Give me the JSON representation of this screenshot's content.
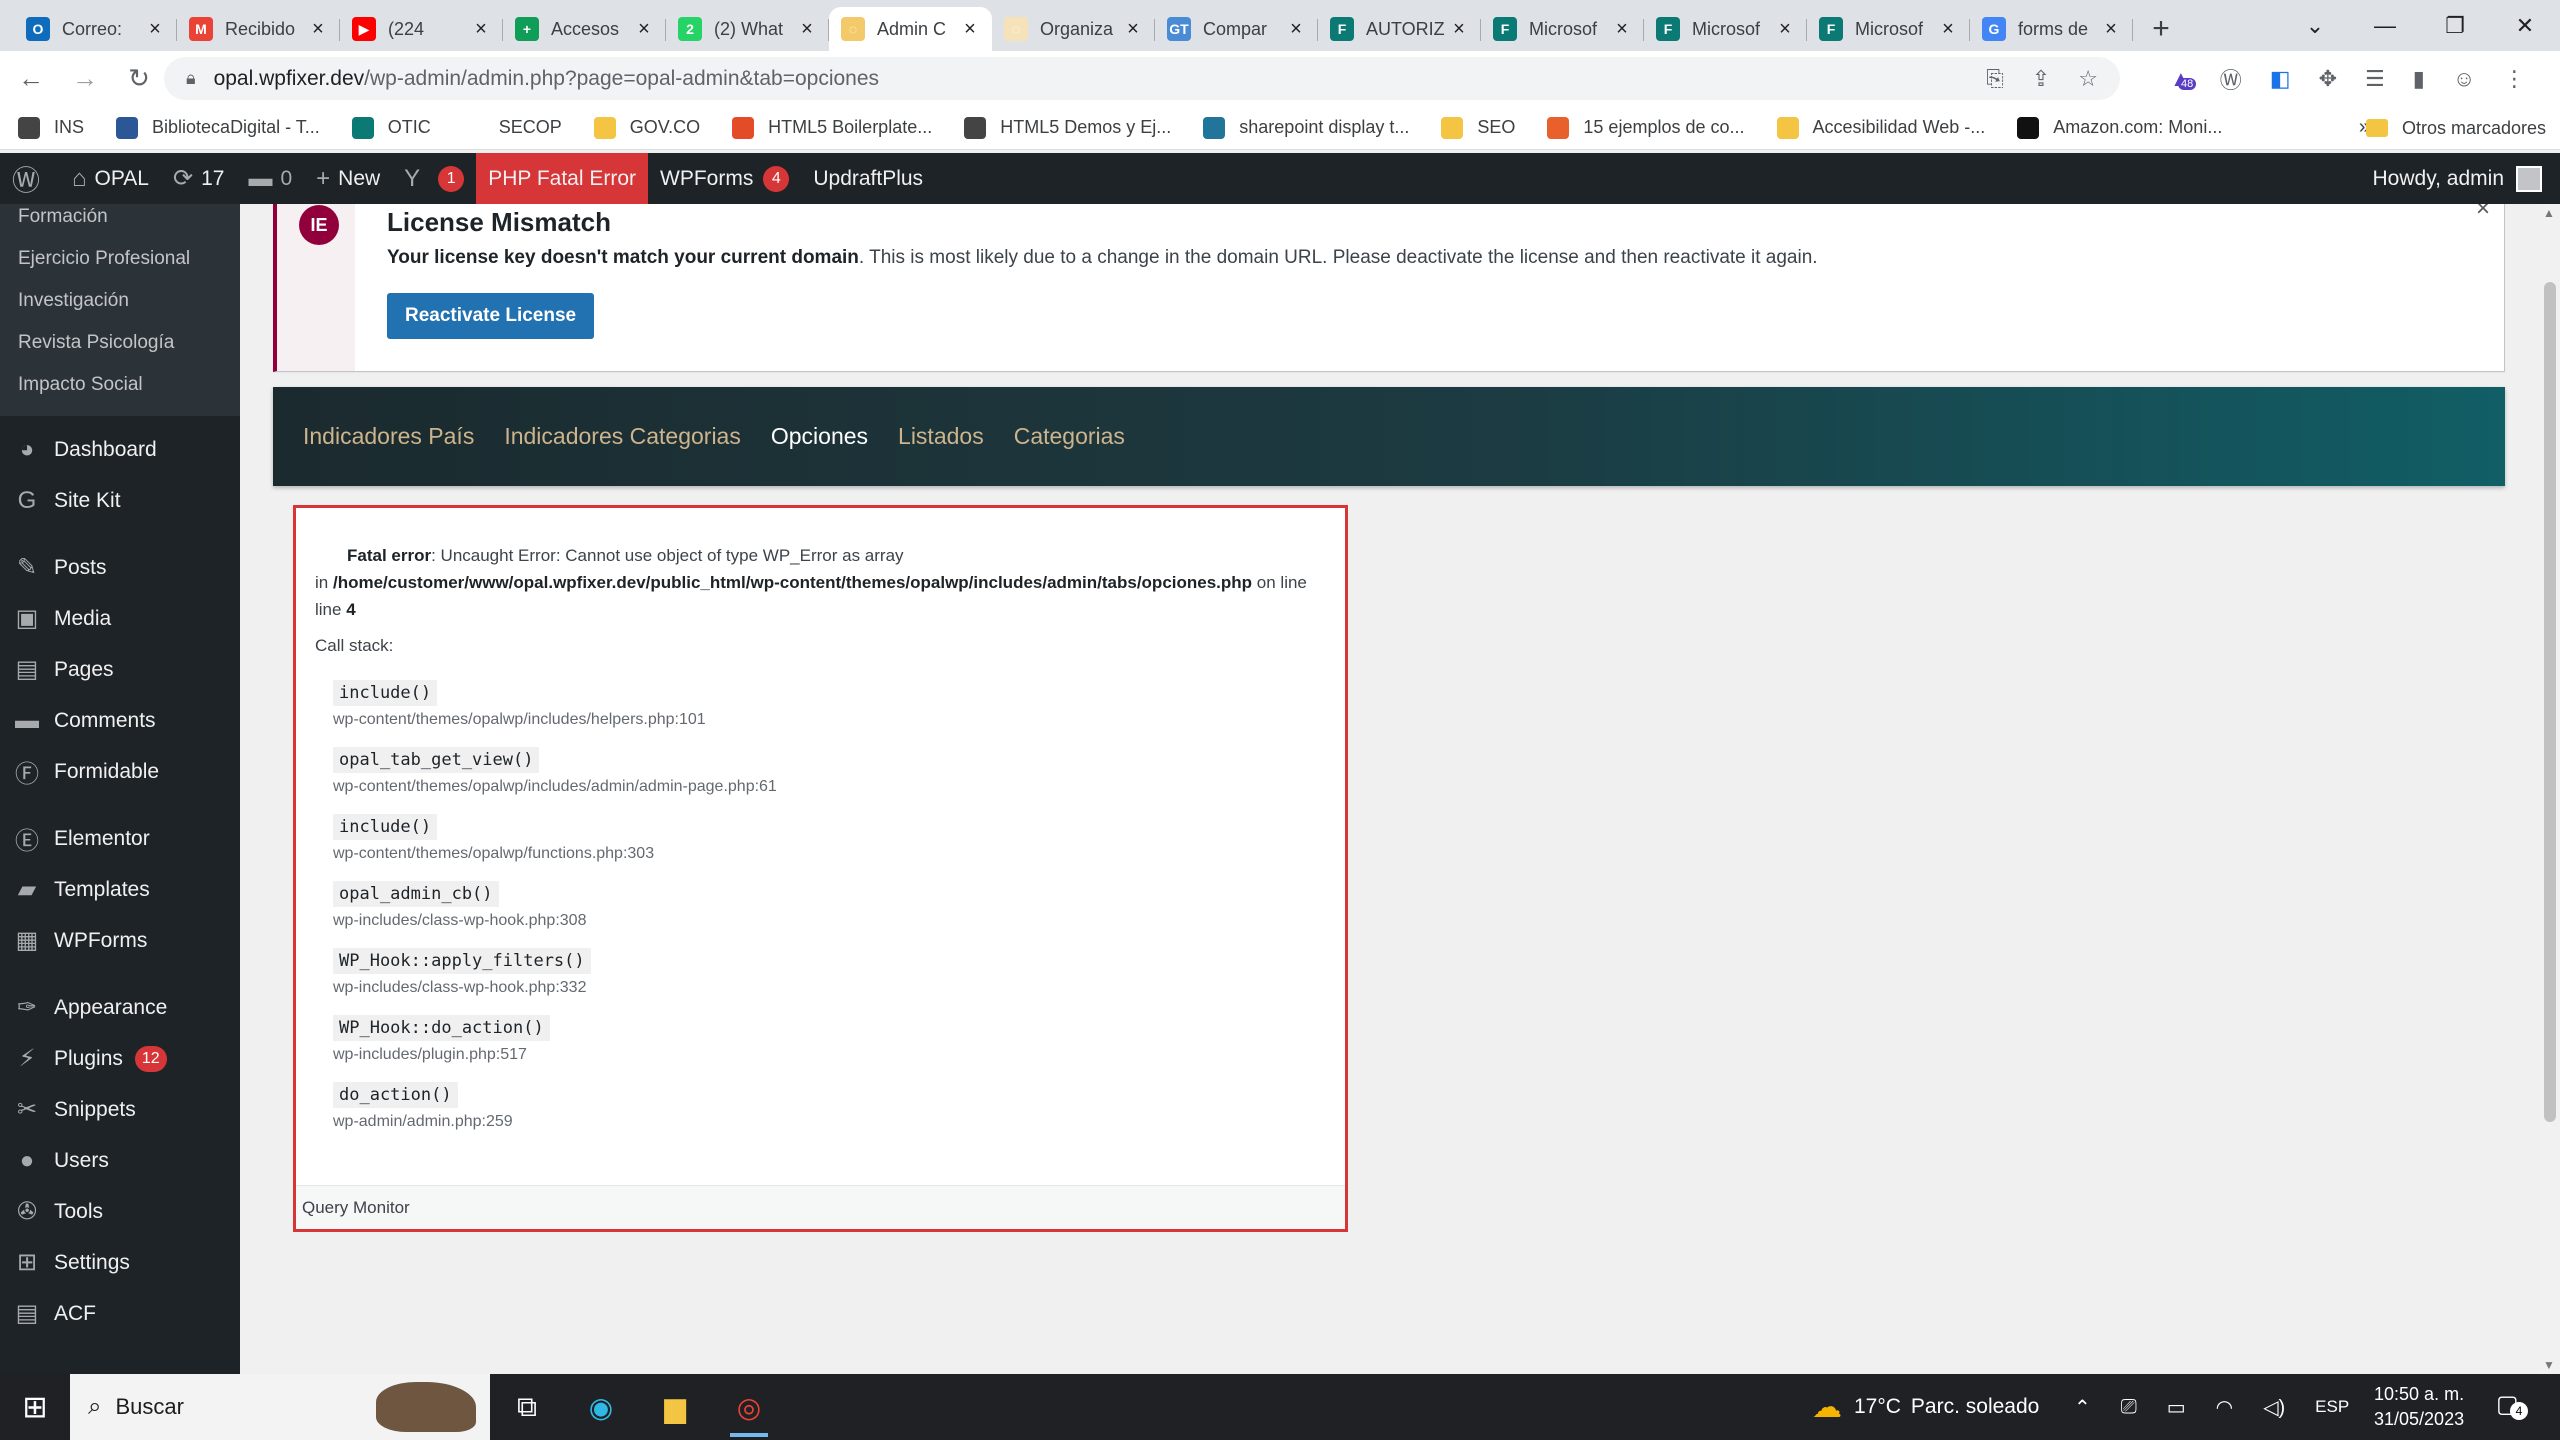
{
  "browser": {
    "tabs": [
      {
        "title": "Correo:",
        "fav": "O",
        "color": "#0f6cbd"
      },
      {
        "title": "Recibido",
        "fav": "M",
        "color": "#ea4335"
      },
      {
        "title": "(224",
        "fav": "▶",
        "color": "#ff0000"
      },
      {
        "title": "Accesos",
        "fav": "+",
        "color": "#0f9d58"
      },
      {
        "title": "(2) What",
        "fav": "2",
        "color": "#25d366"
      },
      {
        "title": "Admin C",
        "fav": "◌",
        "color": "#f4c96a",
        "active": true
      },
      {
        "title": "Organiza",
        "fav": "◌",
        "color": "#f6e2b8"
      },
      {
        "title": "Compar",
        "fav": "GT",
        "color": "#4a8bd6"
      },
      {
        "title": "AUTORIZ",
        "fav": "F",
        "color": "#0b7a75"
      },
      {
        "title": "Microsof",
        "fav": "F",
        "color": "#0b7a75"
      },
      {
        "title": "Microsof",
        "fav": "F",
        "color": "#0b7a75"
      },
      {
        "title": "Microsof",
        "fav": "F",
        "color": "#0b7a75"
      },
      {
        "title": "forms de",
        "fav": "G",
        "color": "#4285f4"
      }
    ],
    "url_host": "opal.wpfixer.dev",
    "url_path": "/wp-admin/admin.php?page=opal-admin&tab=opciones",
    "extension_badge": "48",
    "bookmarks": [
      {
        "label": "INS",
        "color": "#444"
      },
      {
        "label": "BibliotecaDigital - T...",
        "color": "#2b5797"
      },
      {
        "label": "OTIC",
        "color": "#0b7a75"
      },
      {
        "label": "SECOP",
        "color": "#ffffff"
      },
      {
        "label": "GOV.CO",
        "color": "#f4c542"
      },
      {
        "label": "HTML5 Boilerplate...",
        "color": "#e34c26"
      },
      {
        "label": "HTML5 Demos y Ej...",
        "color": "#444"
      },
      {
        "label": "sharepoint display t...",
        "color": "#21759b"
      },
      {
        "label": "SEO",
        "color": "#f4c542"
      },
      {
        "label": "15 ejemplos de co...",
        "color": "#e8612c"
      },
      {
        "label": "Accesibilidad Web -...",
        "color": "#f4c542"
      },
      {
        "label": "Amazon.com: Moni...",
        "color": "#111"
      }
    ],
    "bookmarks_more": "»",
    "other_bookmarks": "Otros marcadores"
  },
  "adminbar": {
    "site_name": "OPAL",
    "updates_count": "17",
    "comments_count": "0",
    "new_label": "New",
    "yoast_badge": "1",
    "fatal_label": "PHP Fatal Error",
    "wpforms_label": "WPForms",
    "wpforms_badge": "4",
    "updraft_label": "UpdraftPlus",
    "howdy": "Howdy, admin"
  },
  "sidebar": {
    "submenu": [
      "Formación",
      "Ejercicio Profesional",
      "Investigación",
      "Revista Psicología",
      "Impacto Social"
    ],
    "menu": [
      {
        "label": "Dashboard",
        "icon": "◕"
      },
      {
        "label": "Site Kit",
        "icon": "G"
      },
      {
        "label": "Posts",
        "icon": "✎",
        "gap": true
      },
      {
        "label": "Media",
        "icon": "▣"
      },
      {
        "label": "Pages",
        "icon": "▤"
      },
      {
        "label": "Comments",
        "icon": "▬"
      },
      {
        "label": "Formidable",
        "icon": "Ⓕ"
      },
      {
        "label": "Elementor",
        "icon": "Ⓔ",
        "gap": true
      },
      {
        "label": "Templates",
        "icon": "▰"
      },
      {
        "label": "WPForms",
        "icon": "▦"
      },
      {
        "label": "Appearance",
        "icon": "✑",
        "gap": true
      },
      {
        "label": "Plugins",
        "icon": "⚡",
        "badge": "12"
      },
      {
        "label": "Snippets",
        "icon": "✂"
      },
      {
        "label": "Users",
        "icon": "●"
      },
      {
        "label": "Tools",
        "icon": "✇"
      },
      {
        "label": "Settings",
        "icon": "⊞"
      },
      {
        "label": "ACF",
        "icon": "▤"
      }
    ]
  },
  "notice": {
    "title": "License Mismatch",
    "message_strong": "Your license key doesn't match your current domain",
    "message_rest": ". This is most likely due to a change in the domain URL. Please deactivate the license and then reactivate it again.",
    "button": "Reactivate License",
    "dismiss": "×"
  },
  "opal_tabs": [
    {
      "label": "Indicadores País"
    },
    {
      "label": "Indicadores Categorias"
    },
    {
      "label": "Opciones",
      "active": true
    },
    {
      "label": "Listados"
    },
    {
      "label": "Categorias"
    }
  ],
  "error": {
    "label": "Fatal error",
    "message": ": Uncaught Error: Cannot use object of type WP_Error as array",
    "in": "in ",
    "file": "/home/customer/www/opal.wpfixer.dev/public_html/wp-content/themes/opalwp/includes/admin/tabs/opciones.php",
    "on_line": " on line ",
    "line": "4",
    "call_stack_label": "Call stack:",
    "stack": [
      {
        "fn": "include()",
        "loc": "wp-content/themes/opalwp/includes/helpers.php:101"
      },
      {
        "fn": "opal_tab_get_view()",
        "loc": "wp-content/themes/opalwp/includes/admin/admin-page.php:61"
      },
      {
        "fn": "include()",
        "loc": "wp-content/themes/opalwp/functions.php:303"
      },
      {
        "fn": "opal_admin_cb()",
        "loc": "wp-includes/class-wp-hook.php:308"
      },
      {
        "fn": "WP_Hook::apply_filters()",
        "loc": "wp-includes/class-wp-hook.php:332"
      },
      {
        "fn": "WP_Hook::do_action()",
        "loc": "wp-includes/plugin.php:517"
      },
      {
        "fn": "do_action()",
        "loc": "wp-admin/admin.php:259"
      }
    ],
    "query_monitor": "Query Monitor"
  },
  "taskbar": {
    "search_placeholder": "Buscar",
    "weather_temp": "17°C",
    "weather_desc": "Parc. soleado",
    "lang": "ESP",
    "time": "10:50 a. m.",
    "date": "31/05/2023",
    "notifications": "4"
  }
}
